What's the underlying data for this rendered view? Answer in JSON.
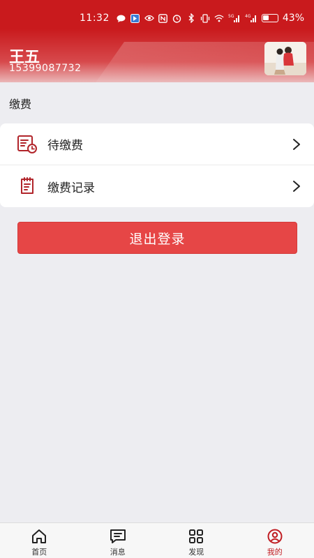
{
  "status_bar": {
    "time": "11:32",
    "battery_percent": "43%",
    "net_a": "5G",
    "net_b": "4G"
  },
  "user": {
    "name": "王五",
    "phone": "15399087732"
  },
  "section": {
    "title": "缴费"
  },
  "menu": {
    "items": [
      {
        "label": "待缴费",
        "icon": "pending-bill-icon"
      },
      {
        "label": "缴费记录",
        "icon": "payment-record-icon"
      }
    ]
  },
  "logout": {
    "label": "退出登录"
  },
  "tabbar": {
    "tabs": [
      {
        "label": "首页",
        "icon": "home-icon"
      },
      {
        "label": "消息",
        "icon": "message-icon"
      },
      {
        "label": "发现",
        "icon": "discover-icon"
      },
      {
        "label": "我的",
        "icon": "profile-icon",
        "active": true
      }
    ]
  },
  "colors": {
    "header": "#c91a1d",
    "accent": "#e64646",
    "active_tab": "#c01d22"
  }
}
